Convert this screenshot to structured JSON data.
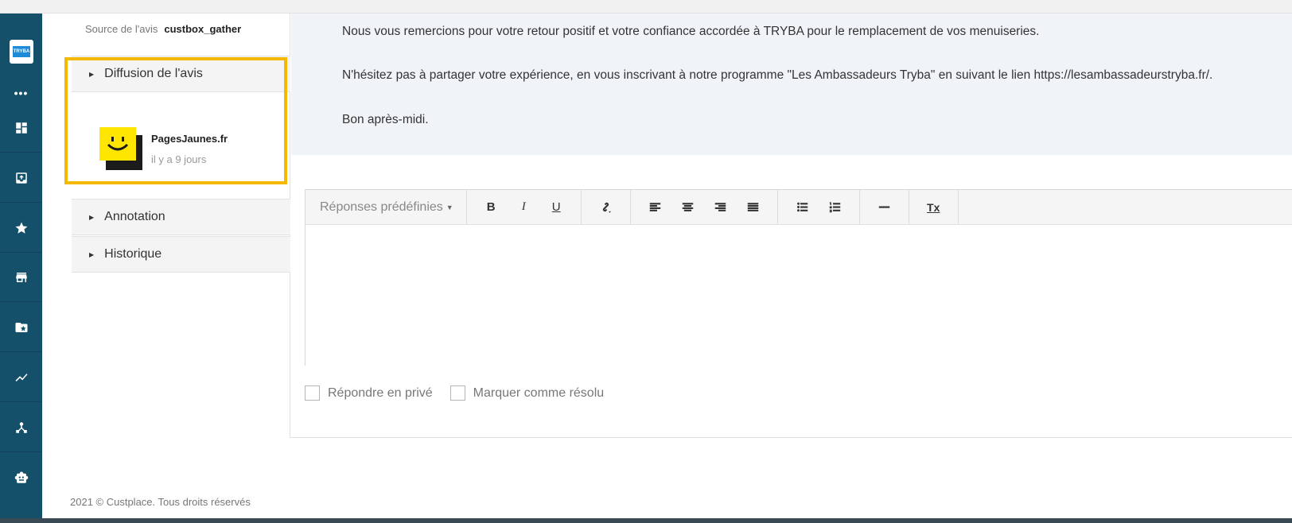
{
  "sidebar": {
    "logo_text": "TRYBA",
    "more": "•••",
    "items": [
      {
        "icon": "dashboard-icon"
      },
      {
        "icon": "inbox-icon"
      },
      {
        "icon": "star-icon"
      },
      {
        "icon": "store-icon"
      },
      {
        "icon": "folder-star-icon"
      },
      {
        "icon": "chart-icon"
      },
      {
        "icon": "network-icon"
      },
      {
        "icon": "robot-icon"
      }
    ]
  },
  "review": {
    "source_label": "Source de l'avis",
    "source_value": "custbox_gather"
  },
  "accordion": {
    "diffusion": "Diffusion de l'avis",
    "annotation": "Annotation",
    "historique": "Historique"
  },
  "diffusion": {
    "platform_name": "PagesJaunes.fr",
    "time_ago": "il y a 9 jours",
    "brand_color": "#ffe600"
  },
  "reply": {
    "line1": "Nous vous remercions pour votre retour positif et votre confiance accordée à TRYBA pour le remplacement de vos menuiseries.",
    "line2": "N'hésitez pas à partager votre expérience, en vous inscrivant à notre programme \"Les Ambassadeurs Tryba\" en suivant le lien https://lesambassadeurstryba.fr/.",
    "line3": "Bon après-midi."
  },
  "editor": {
    "predefined_label": "Réponses prédéfinies",
    "bold": "B",
    "italic": "I",
    "underline": "U",
    "clear_format": "Tx"
  },
  "options": {
    "private_reply": "Répondre en privé",
    "mark_resolved": "Marquer comme résolu"
  },
  "footer": {
    "copyright": "2021 © Custplace. Tous droits réservés"
  },
  "colors": {
    "sidebar_bg": "#14506a",
    "highlight": "#f5b800",
    "reply_bg": "#f0f4f8"
  }
}
